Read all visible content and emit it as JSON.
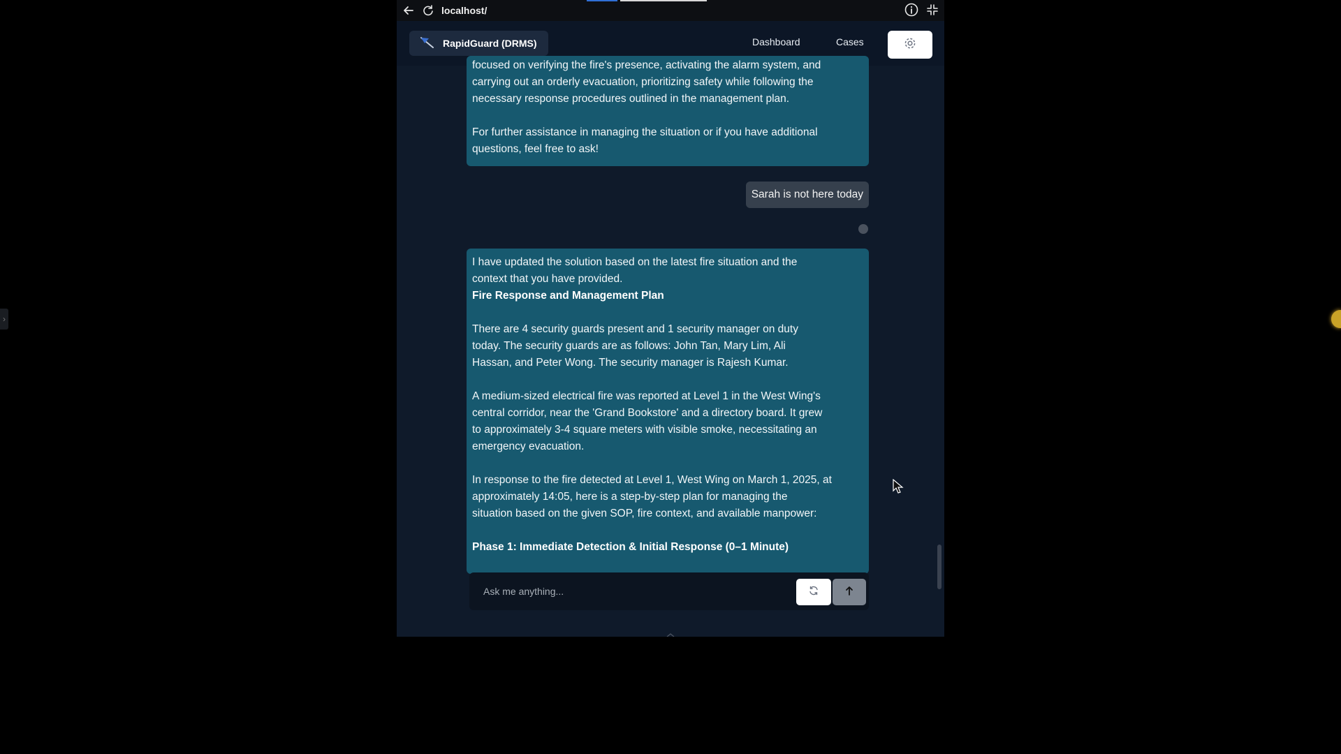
{
  "browser": {
    "url": "localhost/"
  },
  "header": {
    "brand_name": "RapidGuard (DRMS)",
    "nav": {
      "dashboard": "Dashboard",
      "cases": "Cases"
    }
  },
  "chat": {
    "ai_message_1": {
      "line1": "focused on verifying the fire's presence, activating the alarm system, and",
      "line2": "carrying out an orderly evacuation, prioritizing safety while following the",
      "line3": "necessary response procedures outlined in the management plan.",
      "para2_line1": "For further assistance in managing the situation or if you have additional",
      "para2_line2": "questions, feel free to ask!"
    },
    "user_message": "Sarah is not here today",
    "ai_message_2": {
      "intro_1": "I have updated the solution based on the latest fire situation and the",
      "intro_2": "context that you have provided.",
      "heading": "Fire Response and Management Plan",
      "staff_1": "There are 4 security guards present and 1 security manager on duty",
      "staff_2": "today. The security guards are as follows: John Tan, Mary Lim, Ali",
      "staff_3": "Hassan, and Peter Wong. The security manager is Rajesh Kumar.",
      "fire_1": "A medium-sized electrical fire was reported at Level 1 in the West Wing's",
      "fire_2": "central corridor, near the 'Grand Bookstore' and a directory board. It grew",
      "fire_3": "to approximately 3-4 square meters with visible smoke, necessitating an",
      "fire_4": "emergency evacuation.",
      "plan_1": "In response to the fire detected at Level 1, West Wing on March 1, 2025, at",
      "plan_2": "approximately 14:05, here is a step-by-step plan for managing the",
      "plan_3": "situation based on the given SOP, fire context, and available manpower:",
      "phase1": "Phase 1: Immediate Detection & Initial Response (0–1 Minute)"
    },
    "input": {
      "placeholder": "Ask me anything..."
    }
  },
  "icons": {
    "back": "arrow-left-icon",
    "reload": "reload-icon",
    "info": "info-icon",
    "minimize": "collapse-icon",
    "settings": "gear-icon",
    "refresh": "refresh-icon",
    "send": "arrow-up-icon"
  },
  "colors": {
    "ai_bubble": "#17596f",
    "user_bubble": "#36404d",
    "page_bg": "#0f1a2a",
    "header_bg": "#0c1626"
  }
}
